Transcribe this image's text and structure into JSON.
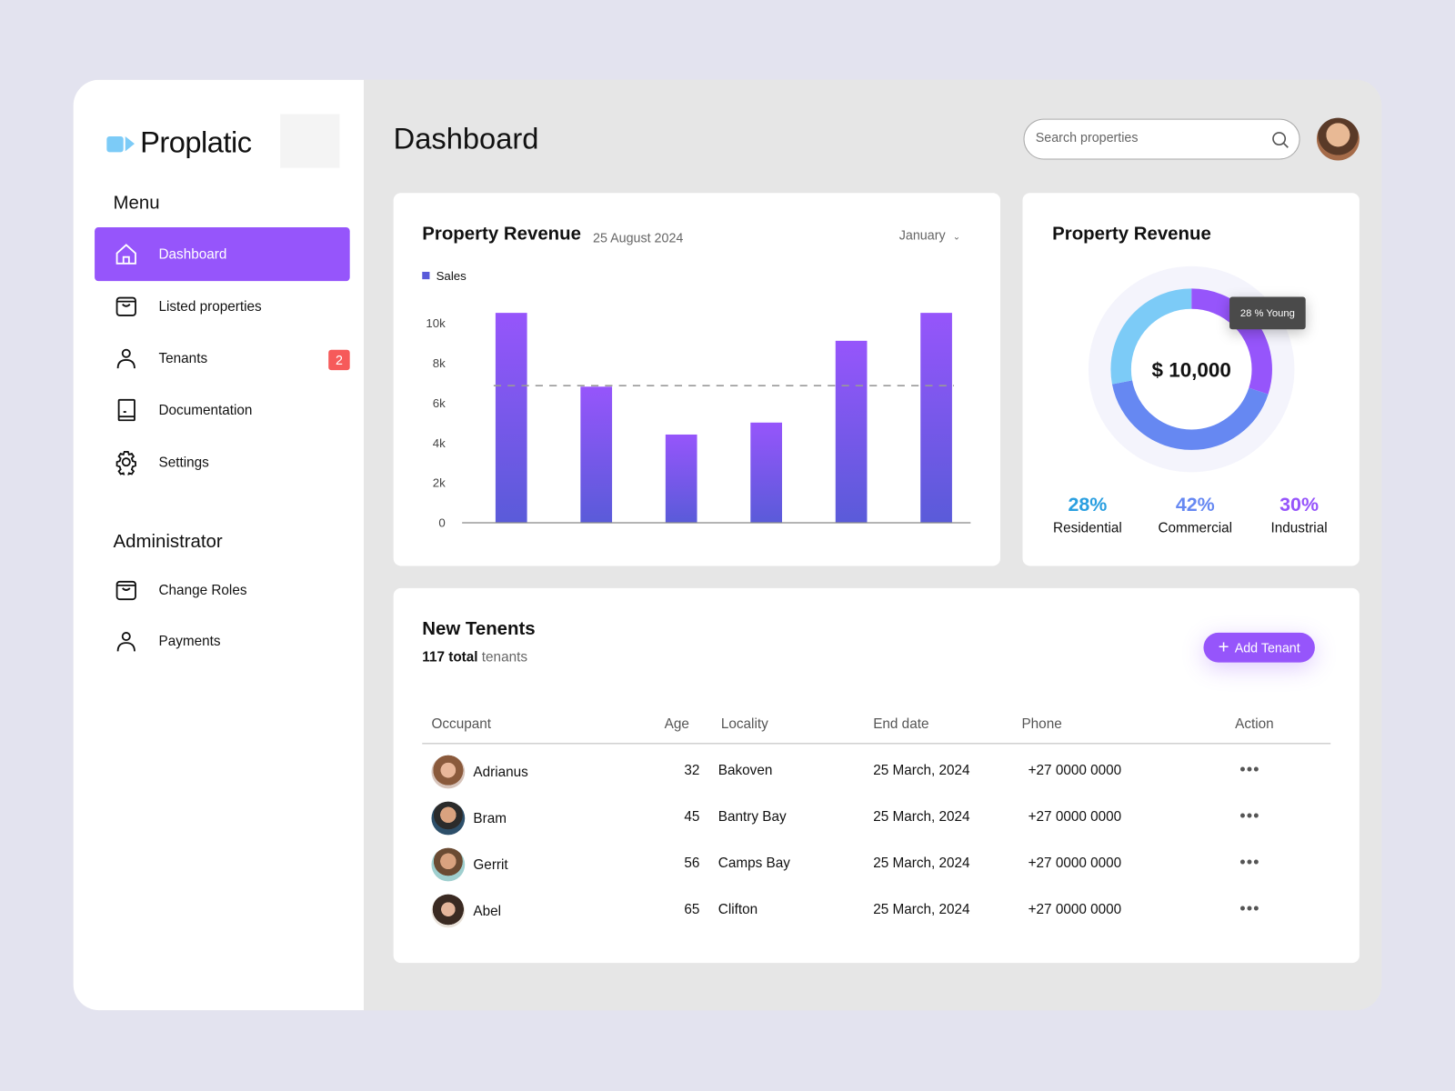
{
  "brand": {
    "name": "Proplatic",
    "color": "#7ccbf7"
  },
  "sidebar": {
    "menu_title": "Menu",
    "items": [
      {
        "label": "Dashboard",
        "icon": "home-icon",
        "active": true
      },
      {
        "label": "Listed properties",
        "icon": "bag-icon"
      },
      {
        "label": "Tenants",
        "icon": "user-icon",
        "badge": "2"
      },
      {
        "label": "Documentation",
        "icon": "book-icon"
      },
      {
        "label": "Settings",
        "icon": "gear-icon"
      }
    ],
    "admin_title": "Administrator",
    "admin_items": [
      {
        "label": "Change Roles",
        "icon": "bag-icon"
      },
      {
        "label": "Payments",
        "icon": "user-icon"
      }
    ]
  },
  "header": {
    "title": "Dashboard",
    "search_placeholder": "Search properties"
  },
  "revenue_chart": {
    "title": "Property Revenue",
    "date": "25 August 2024",
    "period": "January"
  },
  "donut_card": {
    "title": "Property Revenue",
    "total": "$ 10,000",
    "tooltip": "28 % Young"
  },
  "colors": {
    "accent": "#9655fb",
    "bar_top": "#9655fb",
    "bar_bottom": "#5a5bd9",
    "residential": "#7ccbf7",
    "commercial": "#6688f2",
    "industrial": "#9655fb",
    "badge": "#f65a5a"
  },
  "chart_data": [
    {
      "type": "bar",
      "legend": [
        "Sales"
      ],
      "series": [
        {
          "name": "Sales",
          "values": [
            10500,
            6800,
            4400,
            5000,
            9100,
            10500
          ]
        }
      ],
      "reference_line": 6850,
      "yticks": [
        "0",
        "2k",
        "4k",
        "6k",
        "8k",
        "10k"
      ],
      "ylim": [
        0,
        10000
      ],
      "legend_position": "top-left",
      "grid": false
    },
    {
      "type": "pie",
      "slices": [
        {
          "label": "Residential",
          "value": 28,
          "display": "28%"
        },
        {
          "label": "Commercial",
          "value": 42,
          "display": "42%"
        },
        {
          "label": "Industrial",
          "value": 30,
          "display": "30%"
        }
      ]
    }
  ],
  "tenants": {
    "title": "New Tenents",
    "total": "117 total",
    "total_suffix": "tenants",
    "add_label": "Add Tenant",
    "columns": [
      "Occupant",
      "Age",
      "Locality",
      "End date",
      "Phone",
      "Action"
    ],
    "rows": [
      {
        "name": "Adrianus",
        "age": "32",
        "locality": "Bakoven",
        "end": "25 March, 2024",
        "phone": "+27 0000 0000",
        "action": "•••"
      },
      {
        "name": "Bram",
        "age": "45",
        "locality": "Bantry Bay",
        "end": "25 March, 2024",
        "phone": "+27 0000 0000",
        "action": "•••"
      },
      {
        "name": "Gerrit",
        "age": "56",
        "locality": "Camps Bay",
        "end": "25 March, 2024",
        "phone": "+27 0000 0000",
        "action": "•••"
      },
      {
        "name": "Abel",
        "age": "65",
        "locality": "Clifton",
        "end": "25 March, 2024",
        "phone": "+27 0000 0000",
        "action": "•••"
      }
    ]
  }
}
